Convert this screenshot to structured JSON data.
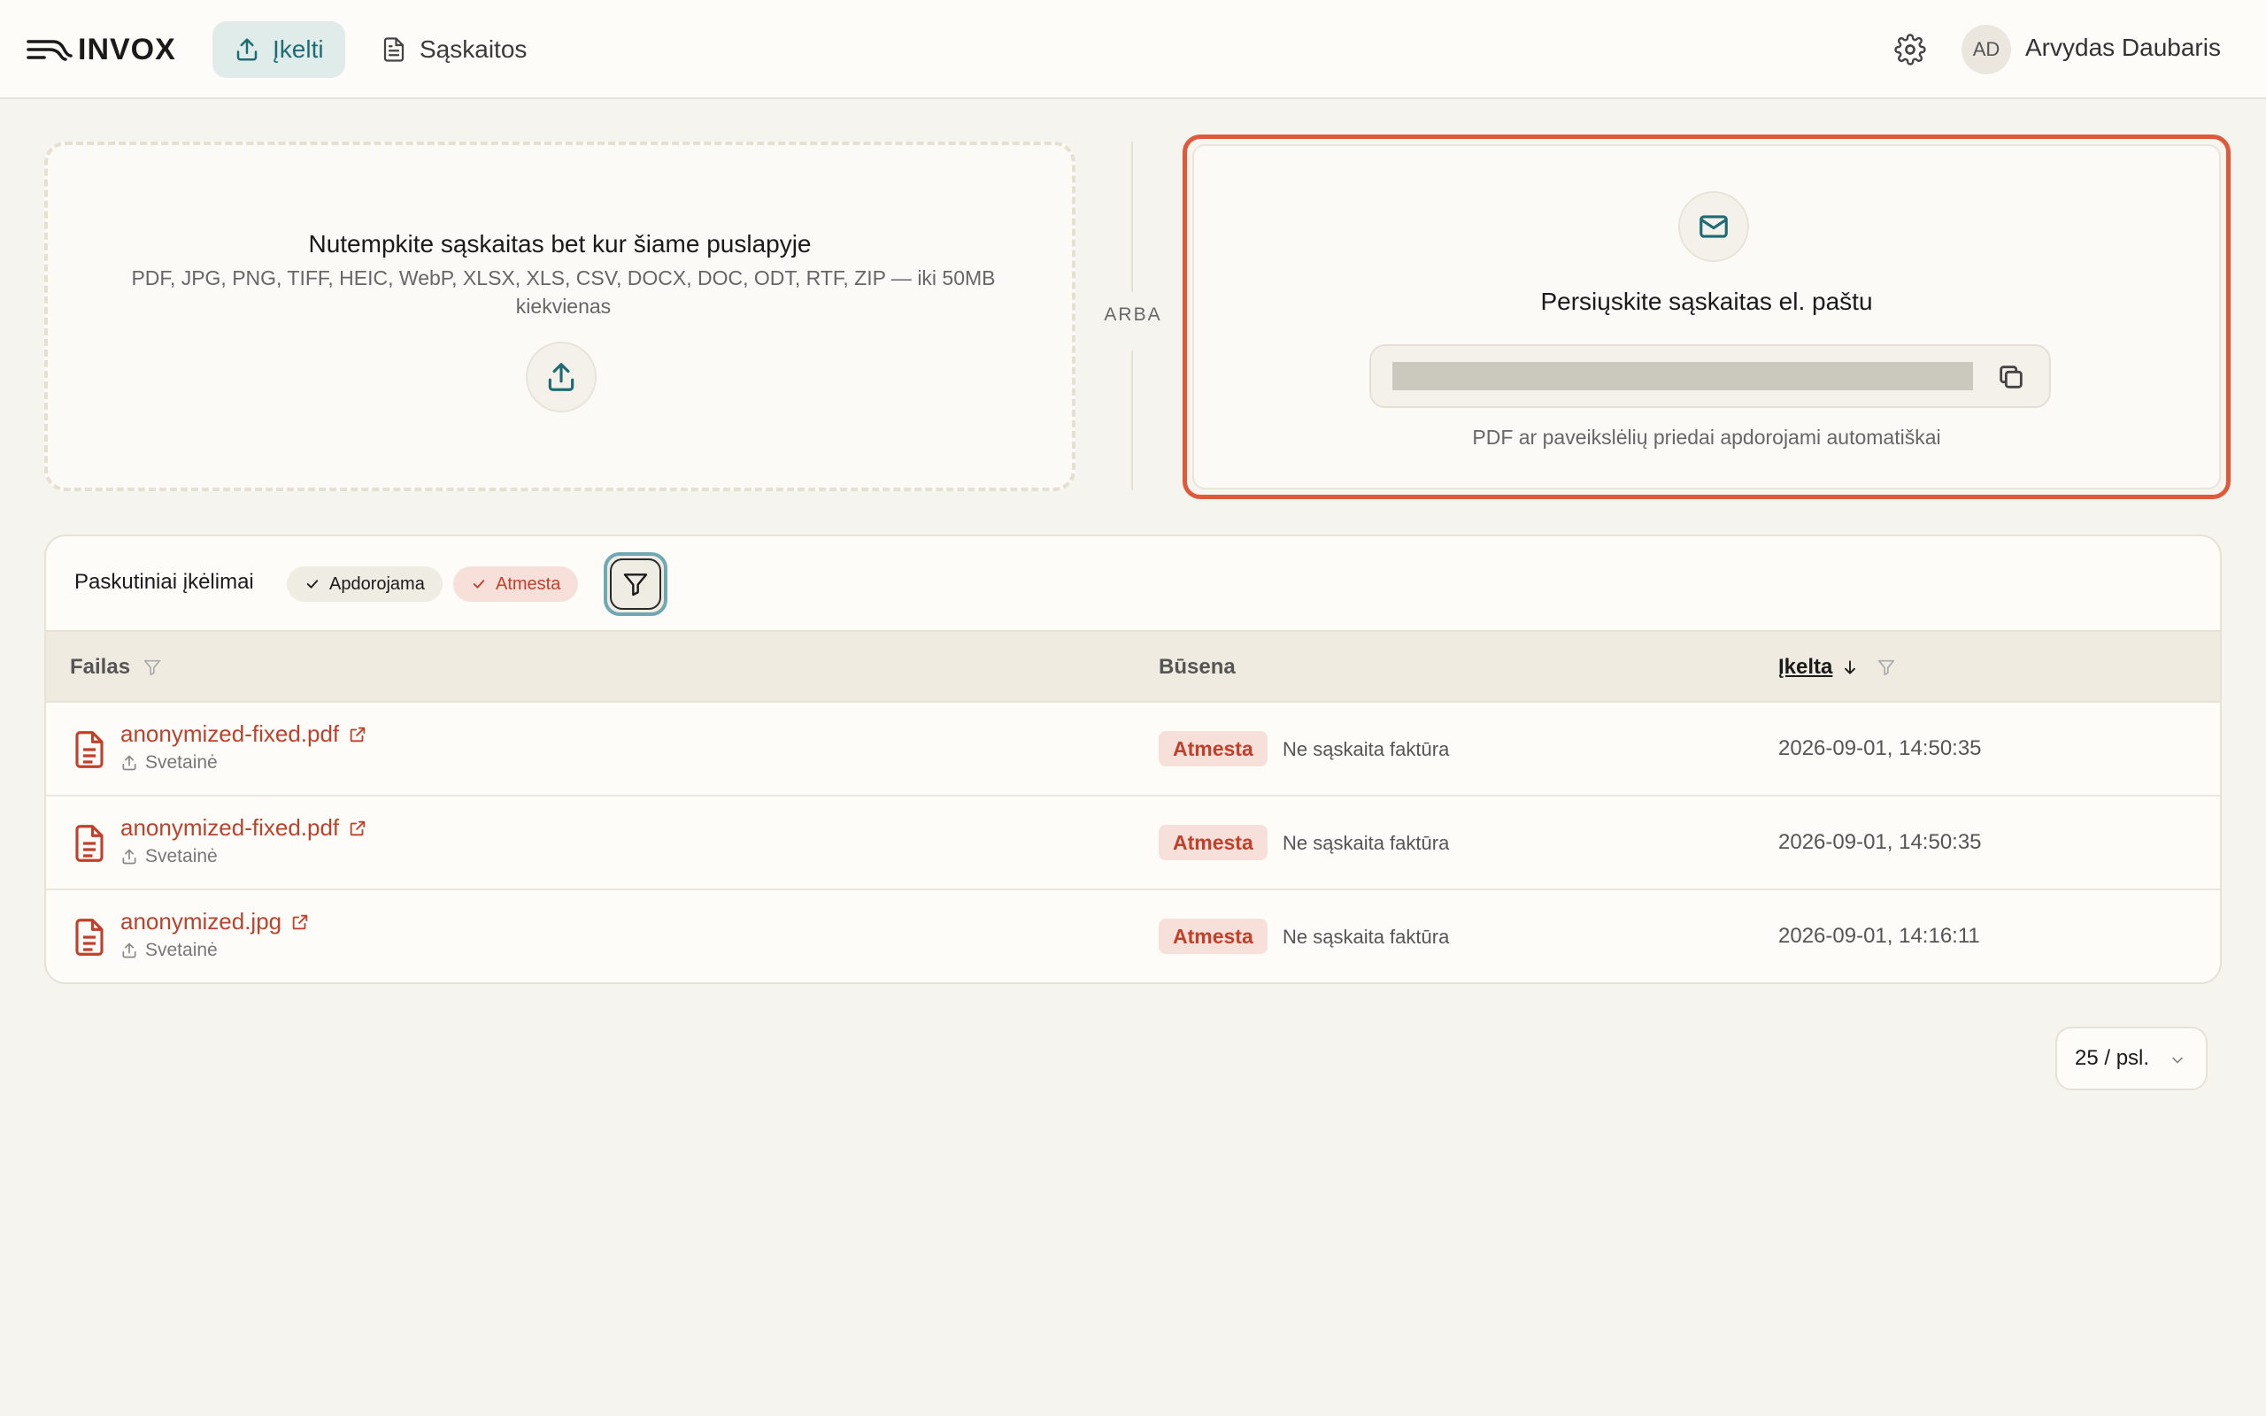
{
  "app": {
    "name": "INVOX"
  },
  "nav": {
    "upload_label": "Įkelti",
    "invoices_label": "Sąskaitos"
  },
  "user": {
    "initials": "AD",
    "name": "Arvydas Daubaris"
  },
  "upload": {
    "title": "Nutempkite sąskaitas bet kur šiame puslapyje",
    "formats": "PDF, JPG, PNG, TIFF, HEIC, WebP, XLSX, XLS, CSV, DOCX, DOC, ODT, RTF, ZIP — iki 50MB kiekvienas"
  },
  "separator": "ARBA",
  "email": {
    "title": "Persiųskite sąskaitas el. paštu",
    "note": "PDF ar paveikslėlių priedai apdorojami automatiškai"
  },
  "recent": {
    "title": "Paskutiniai įkėlimai",
    "chips": [
      "Apdorojama",
      "Atmesta"
    ],
    "columns": {
      "file": "Failas",
      "status": "Būsena",
      "uploaded": "Įkelta"
    },
    "rows": [
      {
        "name": "anonymized-fixed.pdf",
        "source": "Svetainė",
        "status": "Atmesta",
        "reason": "Ne sąskaita faktūra",
        "date": "2026-09-01, 14:50:35"
      },
      {
        "name": "anonymized-fixed.pdf",
        "source": "Svetainė",
        "status": "Atmesta",
        "reason": "Ne sąskaita faktūra",
        "date": "2026-09-01, 14:50:35"
      },
      {
        "name": "anonymized.jpg",
        "source": "Svetainė",
        "status": "Atmesta",
        "reason": "Ne sąskaita faktūra",
        "date": "2026-09-01, 14:16:11"
      }
    ]
  },
  "pagination": {
    "page_size": "25 / psl."
  },
  "colors": {
    "accent": "#1f6b73",
    "danger": "#c0402a",
    "highlight_border": "#e0593a",
    "background": "#f6f4ef"
  }
}
